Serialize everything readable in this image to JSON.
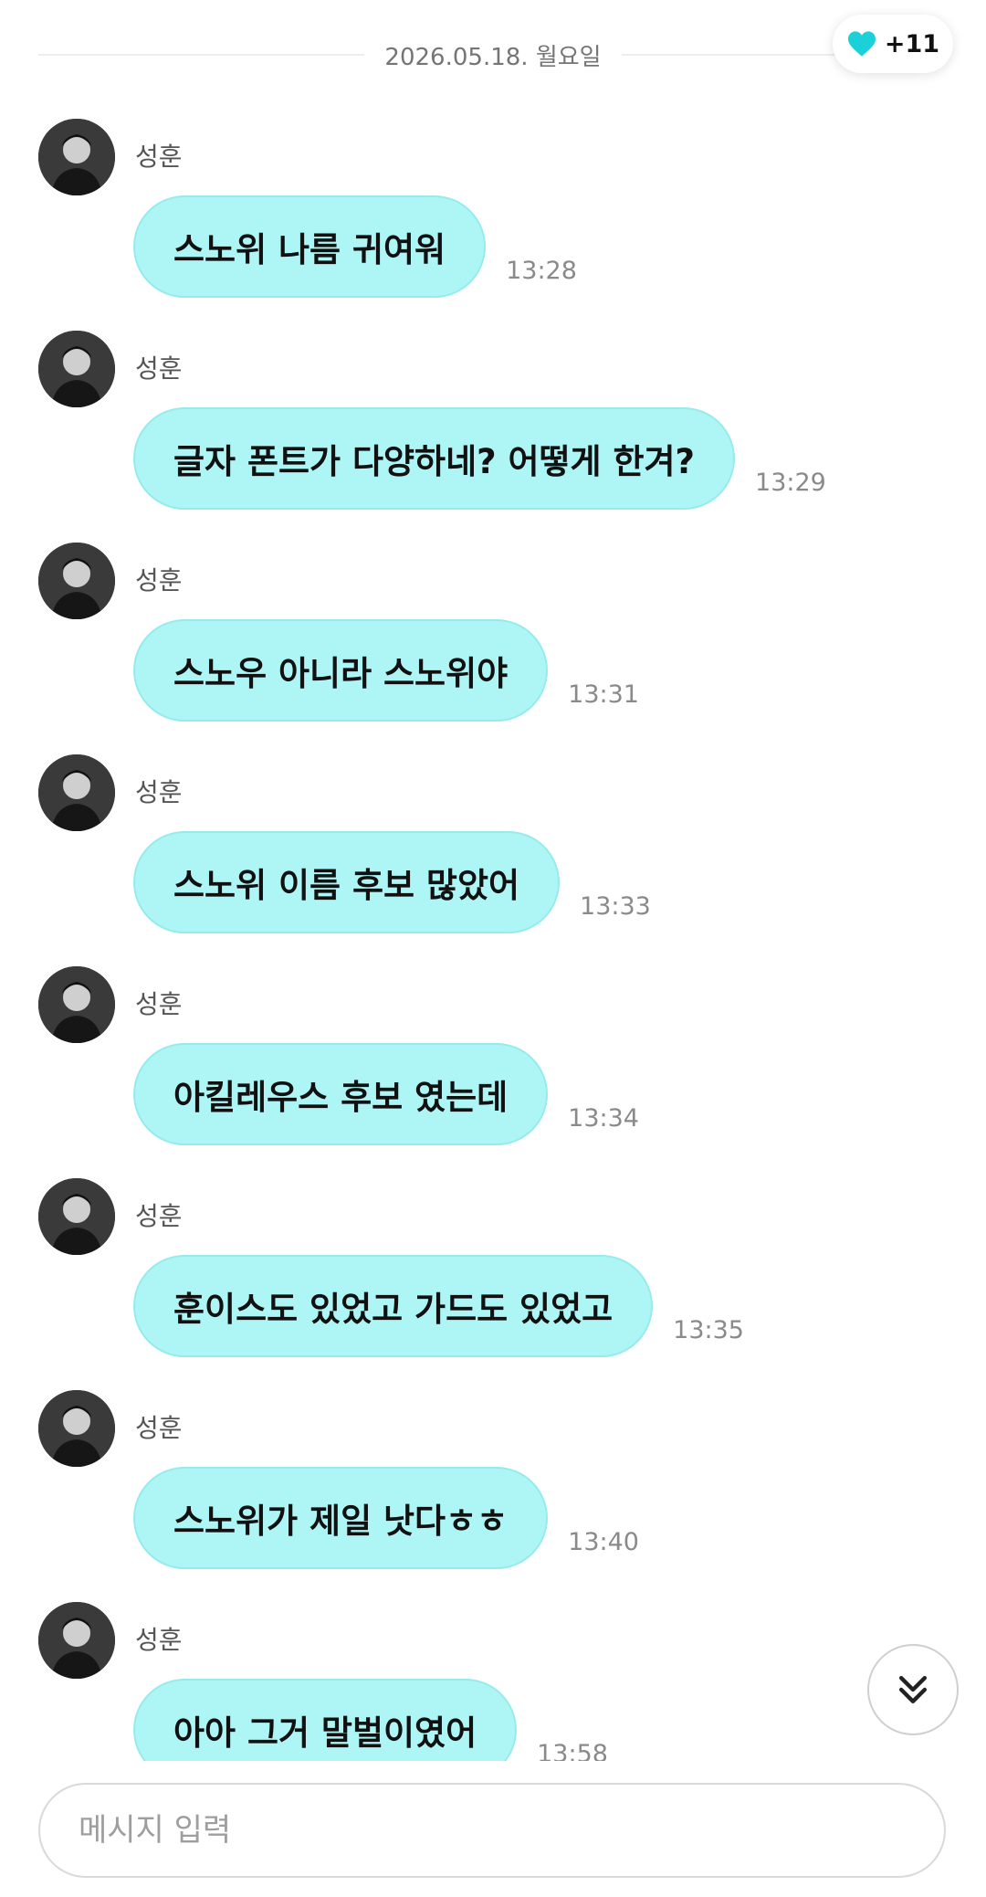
{
  "date_separator": "2026.05.18. 월요일",
  "heart": {
    "icon": "heart-icon",
    "count": "+11",
    "color": "#1ad1d9"
  },
  "colors": {
    "bubble": "#aef5f5",
    "accent": "#1ad1d9"
  },
  "messages": [
    {
      "sender": "성훈",
      "text": "스노위 나름 귀여워",
      "time": "13:28"
    },
    {
      "sender": "성훈",
      "text": "글자 폰트가 다양하네? 어떻게 한겨?",
      "time": "13:29"
    },
    {
      "sender": "성훈",
      "text": "스노우 아니라 스노위야",
      "time": "13:31"
    },
    {
      "sender": "성훈",
      "text": "스노위 이름 후보 많았어",
      "time": "13:33"
    },
    {
      "sender": "성훈",
      "text": "아킬레우스 후보 였는데",
      "time": "13:34"
    },
    {
      "sender": "성훈",
      "text": "훈이스도 있었고 가드도 있었고",
      "time": "13:35"
    },
    {
      "sender": "성훈",
      "text": "스노위가 제일 낫다ㅎㅎ",
      "time": "13:40"
    },
    {
      "sender": "성훈",
      "text": "아아 그거 말벌이였어",
      "time": "13:58"
    }
  ],
  "scroll_button": {
    "icon": "double-chevron-down-icon"
  },
  "composer": {
    "placeholder": "메시지 입력",
    "value": ""
  }
}
